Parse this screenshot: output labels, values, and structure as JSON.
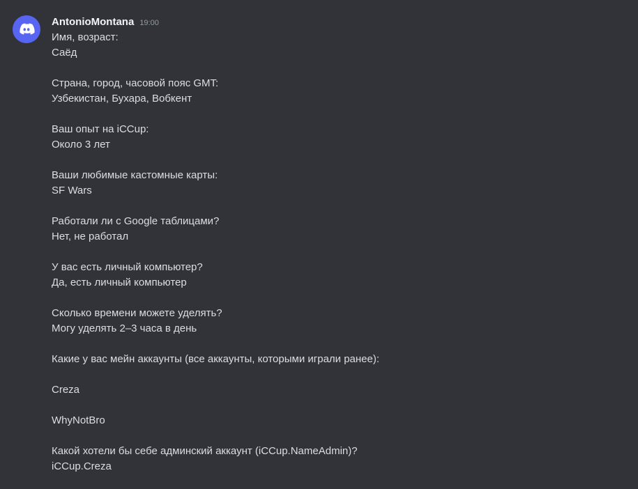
{
  "message": {
    "username": "AntonioMontana",
    "timestamp": "19:00",
    "avatar_icon": "discord-logo-icon",
    "lines": [
      "Имя, возраст:",
      "Саёд",
      "",
      "Страна, город, часовой пояс GMT:",
      "Узбекистан, Бухара, Вобкент",
      "",
      "Ваш опыт на iCCup:",
      "Около 3 лет",
      "",
      "Ваши любимые кастомные карты:",
      "SF Wars",
      "",
      "Работали ли с Google таблицами?",
      "Нет, не работал",
      "",
      "У вас есть личный компьютер?",
      "Да, есть личный компьютер",
      "",
      "Сколько времени можете уделять?",
      "Могу уделять 2–3 часа в день",
      "",
      "Какие у вас мейн аккаунты (все аккаунты, которыми играли ранее):",
      "",
      "Creza",
      "",
      "WhyNotBro",
      "",
      "Какой хотели бы себе админский аккаунт (iCCup.NameAdmin)?",
      "iCCup.Creza"
    ]
  },
  "colors": {
    "background": "#313338",
    "text": "#dbdee1",
    "username": "#f2f3f5",
    "timestamp": "#949ba4",
    "avatar": "#5865f2"
  }
}
